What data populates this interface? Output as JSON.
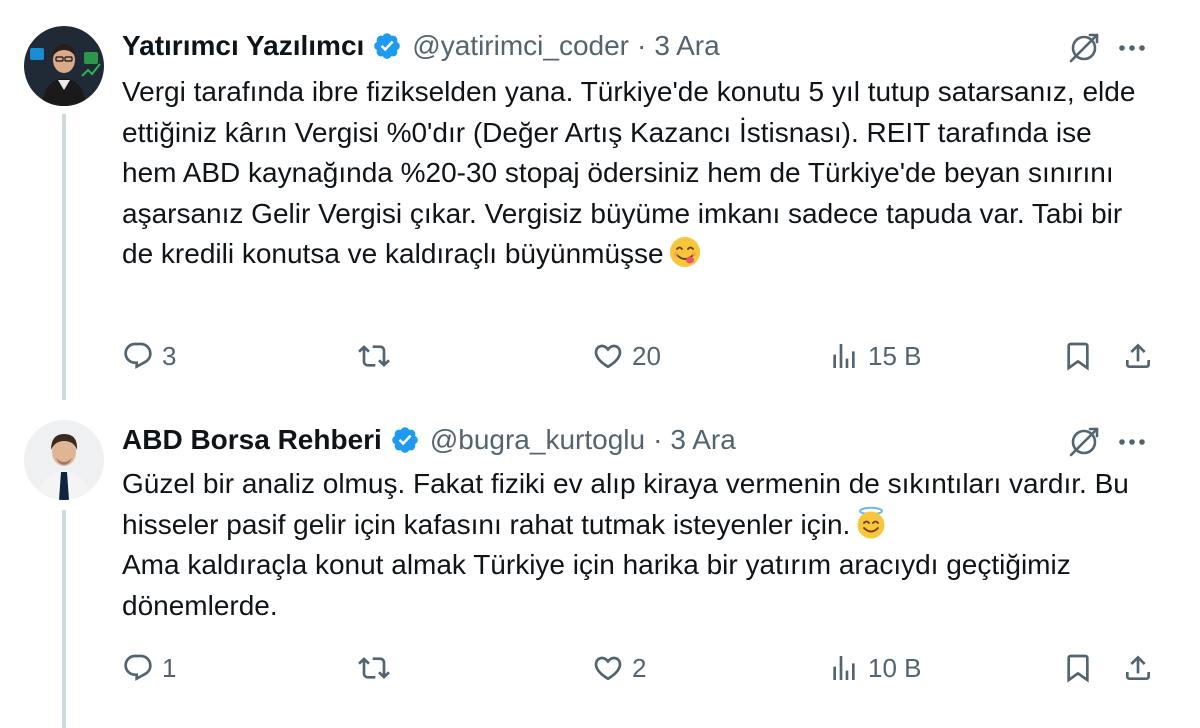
{
  "tweets": [
    {
      "author": "Yatırımcı Yazılımcı",
      "handle": "@yatirimci_coder",
      "separator": "·",
      "time": "3 Ara",
      "text": "Vergi tarafında ibre fizikselden yana. Türkiye'de konutu 5 yıl tutup satarsanız, elde ettiğiniz kârın Vergisi %0'dır (Değer Artış Kazancı İstisnası). REIT tarafında ise hem ABD kaynağında %20-30 stopaj ödersiniz hem de Türkiye'de beyan sınırını aşarsanız Gelir Vergisi çıkar. Vergisiz büyüme imkanı sadece tapuda var. Tabi bir de kredili konutsa ve kaldıraçlı büyünmüşse",
      "emoji": "face-savoring-food",
      "replies": "3",
      "retweets": "",
      "likes": "20",
      "views": "15 B"
    },
    {
      "author": "ABD Borsa Rehberi",
      "handle": "@bugra_kurtoglu",
      "separator": "·",
      "time": "3 Ara",
      "text_part1": "Güzel bir analiz olmuş. Fakat fiziki ev alıp kiraya vermenin de sıkıntıları vardır. Bu hisseler pasif gelir için kafasını rahat tutmak isteyenler için.",
      "emoji": "smiling-face-with-halo",
      "text_part2": "Ama kaldıraçla konut almak Türkiye için harika bir yatırım aracıydı geçtiğimiz dönemlerde.",
      "replies": "1",
      "retweets": "",
      "likes": "2",
      "views": "10 B"
    }
  ],
  "colors": {
    "text": "#0f1419",
    "secondary": "#536471",
    "verified": "#1d9bf0",
    "thread_line": "#cfd9de"
  }
}
